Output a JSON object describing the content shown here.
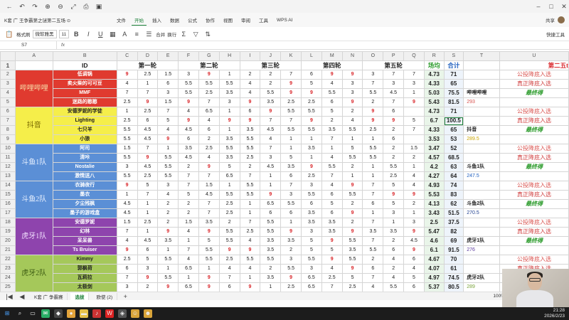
{
  "window": {
    "doc_title": "K套 广 王争霸第之谜第二五场 ⊙"
  },
  "menu": {
    "items": [
      "文件",
      "开始",
      "插入",
      "数据",
      "公式",
      "协作",
      "视图",
      "审阅",
      "工具",
      "WPS AI"
    ],
    "active_index": 1,
    "share": "共享"
  },
  "toolbar": {
    "format_painter": "格式刷",
    "font": "微软雅黑",
    "font_size": "11",
    "bold": "B",
    "italic": "I",
    "underline": "U",
    "align": "合并",
    "wrap": "换行",
    "right_label": "快捷工具"
  },
  "formula": {
    "cell_ref": "S7",
    "fx": "fx",
    "content": ""
  },
  "columns": [
    "",
    "A",
    "B",
    "C",
    "D",
    "E",
    "F",
    "G",
    "H",
    "I",
    "J",
    "K",
    "L",
    "M",
    "N",
    "O",
    "P",
    "Q",
    "R",
    "S",
    "T",
    "U"
  ],
  "header_row": {
    "row_num": "1",
    "id": "ID",
    "rounds": [
      "第一轮",
      "第二轮",
      "第三轮",
      "第四轮",
      "第五轮"
    ],
    "avg": "场均",
    "total": "合计",
    "u": "第二五t"
  },
  "teams": [
    {
      "label": "哔哩哔哩",
      "bg": "#e03a2f",
      "fg": "#f6d9a6",
      "rows": [
        {
          "n": "2",
          "name": "低调锅",
          "s": [
            "9",
            "2.5",
            "1.5",
            "3",
            "9",
            "1",
            "2",
            "2",
            "7",
            "6",
            "9",
            "9",
            "3",
            "7",
            "7"
          ],
          "avg": "4.73",
          "tot": "71",
          "t": "",
          "u": "公投降底入选"
        },
        {
          "n": "3",
          "name": "卖火柴的可可豆",
          "s": [
            "4",
            "1",
            "6",
            "5.5",
            "5.5",
            "5.5",
            "4",
            "2",
            "9",
            "5",
            "4",
            "3",
            "7",
            "3",
            "3"
          ],
          "avg": "4.33",
          "tot": "65",
          "t": "",
          "u": "真正降底入选"
        },
        {
          "n": "4",
          "name": "MMF",
          "s": [
            "7",
            "7",
            "3",
            "5.5",
            "2.5",
            "3.5",
            "4",
            "5.5",
            "9",
            "9",
            "5.5",
            "3",
            "5.5",
            "4.5",
            "1"
          ],
          "avg": "5.03",
          "tot": "75.5",
          "t": "哔哩哔哩",
          "u": "最终得"
        },
        {
          "n": "5",
          "name": "迷路的憨憨",
          "s": [
            "2.5",
            "9",
            "1.5",
            "9",
            "7",
            "3",
            "9",
            "3.5",
            "2.5",
            "2.5",
            "6",
            "9",
            "2",
            "7",
            "9"
          ],
          "avg": "5.43",
          "tot": "81.5",
          "t": "293",
          "u": ""
        }
      ]
    },
    {
      "label": "抖音",
      "bg": "#f5ee4a",
      "fg": "#7a6a00",
      "rows": [
        {
          "n": "6",
          "name": "安德罗妮的学徒",
          "s": [
            "1",
            "2.5",
            "7",
            "4",
            "6.5",
            "1",
            "6",
            "9",
            "5.5",
            "5.5",
            "5",
            "2",
            "9",
            "6"
          ],
          "avg": "4.73",
          "tot": "71",
          "t": "",
          "u": "公投降底入选"
        },
        {
          "n": "7",
          "name": "Lighting",
          "s": [
            "2.5",
            "6",
            "5",
            "9",
            "4",
            "9",
            "9",
            "7",
            "7",
            "9",
            "2",
            "4",
            "9",
            "9",
            "5"
          ],
          "avg": "6.7",
          "tot": "100.5",
          "t": "",
          "u": "真正降底入选"
        },
        {
          "n": "8",
          "name": "七只羊",
          "s": [
            "5.5",
            "4.5",
            "4",
            "4.5",
            "6",
            "1",
            "3.5",
            "4.5",
            "5.5",
            "5.5",
            "3.5",
            "5.5",
            "2.5",
            "2",
            "7"
          ],
          "avg": "4.33",
          "tot": "65",
          "t": "抖音",
          "u": "最终得"
        },
        {
          "n": "9",
          "name": "小狼",
          "s": [
            "5.5",
            "4.5",
            "9",
            "6",
            "2",
            "3.5",
            "5.5",
            "4",
            "1",
            "1",
            "7",
            "1",
            "1",
            "6"
          ],
          "avg": "3.53",
          "tot": "53",
          "t": "289.5",
          "u": ""
        }
      ]
    },
    {
      "label": "斗鱼1队",
      "bg": "#5b8fd6",
      "fg": "#e9f1ff",
      "rows": [
        {
          "n": "10",
          "name": "阿司",
          "s": [
            "1.5",
            "7",
            "1",
            "3.5",
            "2.5",
            "5.5",
            "5.5",
            "7",
            "1",
            "3.5",
            "1",
            "5",
            "5.5",
            "2",
            "1.5"
          ],
          "avg": "3.47",
          "tot": "52",
          "t": "",
          "u": "公投降底入选"
        },
        {
          "n": "11",
          "name": "清咔",
          "s": [
            "5.5",
            "9",
            "5.5",
            "4.5",
            "4",
            "3.5",
            "2.5",
            "3",
            "5",
            "1",
            "4",
            "5.5",
            "5.5",
            "2",
            "2"
          ],
          "avg": "4.57",
          "tot": "68.5",
          "t": "",
          "u": "真正降底入选"
        },
        {
          "n": "12",
          "name": "Nostalie",
          "s": [
            "3",
            "4.5",
            "5.5",
            "2",
            "9",
            "5",
            "2",
            "4.5",
            "3.5",
            "9",
            "5.5",
            "2",
            "1",
            "5.5",
            "1"
          ],
          "avg": "4.2",
          "tot": "63",
          "t": "斗鱼1队",
          "u": "最终得"
        },
        {
          "n": "13",
          "name": "激情送八",
          "s": [
            "5.5",
            "2.5",
            "5.5",
            "7",
            "7",
            "6.5",
            "7",
            "1",
            "6",
            "2.5",
            "7",
            "1",
            "1",
            "2.5",
            "4"
          ],
          "avg": "4.27",
          "tot": "64",
          "t": "247.5",
          "u": ""
        }
      ]
    },
    {
      "label": "斗鱼2队",
      "bg": "#5b8fd6",
      "fg": "#e9f1ff",
      "rows": [
        {
          "n": "14",
          "name": "衣骑夜行",
          "s": [
            "9",
            "5",
            "3",
            "7",
            "1.5",
            "1",
            "5.5",
            "1",
            "7",
            "3",
            "4",
            "9",
            "7",
            "5",
            "4"
          ],
          "avg": "4.93",
          "tot": "74",
          "t": "",
          "u": "公投降底入选"
        },
        {
          "n": "15",
          "name": "墨衣",
          "s": [
            "1",
            "7",
            "4",
            "5",
            "4.5",
            "5.5",
            "5.5",
            "9",
            "3",
            "5.5",
            "6",
            "5.5",
            "7",
            "9",
            "9"
          ],
          "avg": "5.53",
          "tot": "83",
          "t": "",
          "u": "真正降底入选"
        },
        {
          "n": "16",
          "name": "夕尘残枫",
          "s": [
            "4.5",
            "1",
            "2",
            "2",
            "7",
            "2.5",
            "1",
            "6.5",
            "5.5",
            "6",
            "5",
            "2",
            "6",
            "5",
            "2"
          ],
          "avg": "4.13",
          "tot": "62",
          "t": "斗鱼2队",
          "u": "最终得"
        },
        {
          "n": "17",
          "name": "墨子的游戏盒",
          "s": [
            "4.5",
            "1",
            "2",
            "2",
            "7",
            "2.5",
            "1",
            "6",
            "6",
            "3.5",
            "6",
            "9",
            "1",
            "3",
            "1"
          ],
          "avg": "3.43",
          "tot": "51.5",
          "t": "270.5",
          "u": ""
        }
      ]
    },
    {
      "label": "虎牙1队",
      "bg": "#8e44ad",
      "fg": "#f3e1ff",
      "rows": [
        {
          "n": "18",
          "name": "安德罗妮",
          "s": [
            "1.5",
            "2.5",
            "2",
            "1.5",
            "3.5",
            "2",
            "7",
            "5.5",
            "1",
            "3.5",
            "3.5",
            "2",
            "7",
            "1",
            "3"
          ],
          "avg": "2.5",
          "tot": "37.5",
          "t": "",
          "u": "公投降底入选"
        },
        {
          "n": "19",
          "name": "幻林",
          "s": [
            "7",
            "1",
            "9",
            "4",
            "9",
            "5.5",
            "2.5",
            "5.5",
            "9",
            "3",
            "3.5",
            "9",
            "3.5",
            "3.5",
            "9"
          ],
          "avg": "5.47",
          "tot": "82",
          "t": "",
          "u": "真正降底入选"
        },
        {
          "n": "20",
          "name": "呆呆兽",
          "s": [
            "4",
            "4.5",
            "3.5",
            "1",
            "5",
            "5.5",
            "4",
            "3.5",
            "3.5",
            "5",
            "9",
            "5.5",
            "7",
            "2",
            "4.5"
          ],
          "avg": "4.6",
          "tot": "69",
          "t": "虎牙1队",
          "u": "最终得"
        },
        {
          "n": "21",
          "name": "Ts Bruiser",
          "s": [
            "9",
            "6",
            "1",
            "7",
            "5.5",
            "9",
            "9",
            "3.5",
            "2",
            "5",
            "5",
            "3.5",
            "5.5",
            "6",
            "9"
          ],
          "avg": "6.1",
          "tot": "91.5",
          "t": "276",
          "u": ""
        }
      ]
    },
    {
      "label": "虎牙2队",
      "bg": "#a5c85a",
      "fg": "#3b5a12",
      "rows": [
        {
          "n": "22",
          "name": "Kimmy",
          "s": [
            "2.5",
            "5",
            "5.5",
            "4",
            "5.5",
            "2.5",
            "5.5",
            "5.5",
            "3",
            "5.5",
            "9",
            "5.5",
            "2",
            "4",
            "6"
          ],
          "avg": "4.67",
          "tot": "70",
          "t": "",
          "u": "公投降底入选"
        },
        {
          "n": "23",
          "name": "郭枫荷",
          "s": [
            "6",
            "3",
            "1",
            "6.5",
            "1",
            "4",
            "4",
            "2",
            "5.5",
            "3",
            "4",
            "9",
            "6",
            "2",
            "4"
          ],
          "avg": "4.07",
          "tot": "61",
          "t": "",
          "u": "真正降底入选"
        },
        {
          "n": "24",
          "name": "瓦莉拉",
          "s": [
            "7",
            "9",
            "5.5",
            "1",
            "9",
            "7",
            "1",
            "3.5",
            "9",
            "6.5",
            "2.5",
            "5",
            "7",
            "4",
            "5"
          ],
          "avg": "4.97",
          "tot": "74.5",
          "t": "虎牙2队",
          "u": "最终得"
        },
        {
          "n": "25",
          "name": "太极剑",
          "s": [
            "3",
            "2",
            "9",
            "6.5",
            "9",
            "6",
            "9",
            "1",
            "2.5",
            "6.5",
            "7",
            "2.5",
            "4",
            "5.5",
            "6"
          ],
          "avg": "5.37",
          "tot": "80.5",
          "t": "289",
          "u": ""
        }
      ]
    }
  ],
  "sheet_tabs": [
    "K套 广 争霸赛",
    "选拔",
    "欧使 (2)"
  ],
  "active_sheet": 0,
  "status": {
    "zoom": "100%"
  },
  "clock": {
    "time": "21:28",
    "date": "2026/2/23"
  }
}
